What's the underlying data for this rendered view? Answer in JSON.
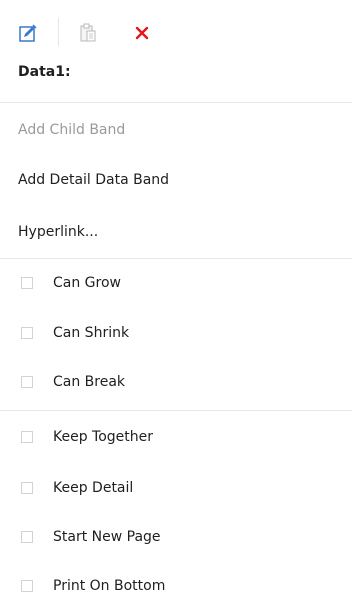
{
  "header": {
    "band_name": "Data1:"
  },
  "toolbar": {
    "edit_icon": "edit-icon",
    "paste_icon": "paste-icon",
    "delete_icon": "delete-icon",
    "delete_color": "#e8141a",
    "edit_color": "#3a78c8"
  },
  "actions": [
    {
      "label": "Add Child Band",
      "enabled": false
    },
    {
      "label": "Add Detail Data Band",
      "enabled": true
    },
    {
      "label": "Hyperlink...",
      "enabled": true
    }
  ],
  "options_group_1": [
    {
      "label": "Can Grow",
      "checked": false
    },
    {
      "label": "Can Shrink",
      "checked": false
    },
    {
      "label": "Can Break",
      "checked": false
    }
  ],
  "options_group_2": [
    {
      "label": "Keep Together",
      "checked": false
    },
    {
      "label": "Keep Detail",
      "checked": false
    },
    {
      "label": "Start New Page",
      "checked": false
    },
    {
      "label": "Print On Bottom",
      "checked": false
    }
  ]
}
